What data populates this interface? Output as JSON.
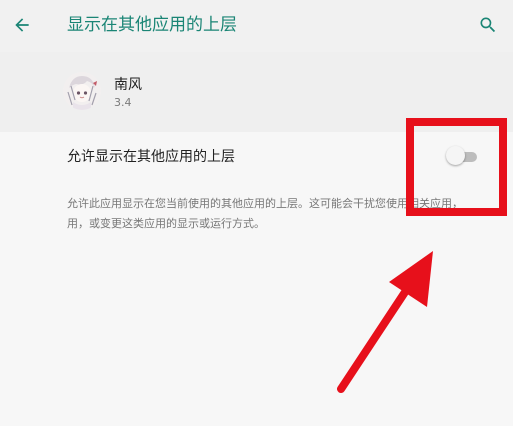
{
  "header": {
    "title": "显示在其他应用的上层",
    "back_icon": "arrow-back-icon",
    "search_icon": "search-icon"
  },
  "app": {
    "name": "南风",
    "version": "3.4",
    "avatar_icon": "app-avatar-icon"
  },
  "overlay_setting": {
    "label": "允许显示在其他应用的上层",
    "enabled": false,
    "description_lines": [
      "允许此应用显示在您当前使用的其他应用的上层。这可能会干扰您使用相关应用，",
      "用，或变更这类应用的显示或运行方式。"
    ]
  },
  "annotations": {
    "highlight_color": "#e7101b"
  },
  "colors": {
    "accent": "#1a8575",
    "background": "#f7f7f7",
    "header_background": "#f1f1f1"
  }
}
